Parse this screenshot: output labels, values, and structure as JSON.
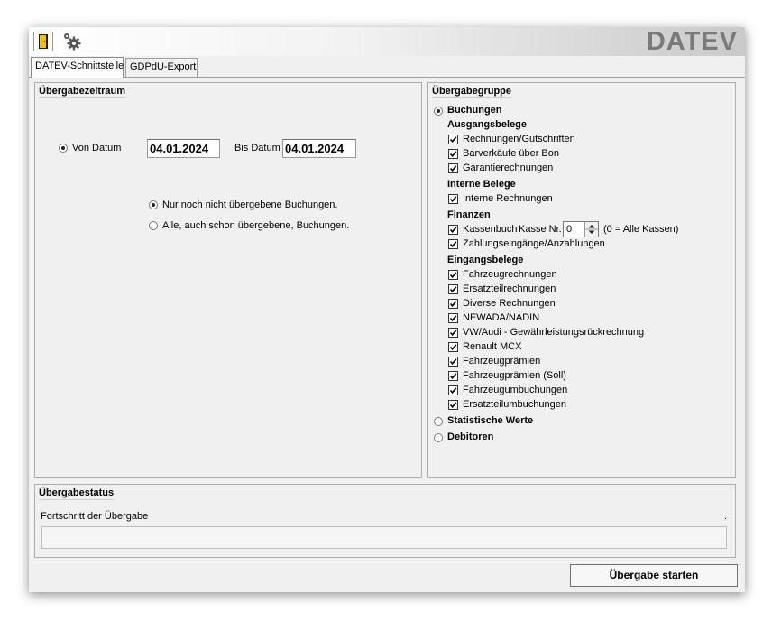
{
  "toolbar": {
    "logo": "DATEV",
    "icons": {
      "exit": "exit-door-icon",
      "settings": "gear-icon"
    },
    "colors": {
      "logo": "#7a7a7a",
      "exit_door": "#f2c200"
    }
  },
  "tabs": [
    {
      "label": "DATEV-Schnittstelle",
      "active": true
    },
    {
      "label": "GDPdU-Export",
      "active": false
    }
  ],
  "period": {
    "title": "Übergabezeitraum",
    "from_label": "Von Datum",
    "from_value": "04.01.2024",
    "to_label": "Bis Datum",
    "to_value": "04.01.2024",
    "option_new": "Nur noch nicht übergebene Buchungen.",
    "option_all": "Alle, auch schon übergebene, Buchungen."
  },
  "group": {
    "title": "Übergabegruppe",
    "bookings": "Buchungen",
    "outgoing": {
      "title": "Ausgangsbelege",
      "items": [
        "Rechnungen/Gutschriften",
        "Barverkäufe über Bon",
        "Garantierechnungen"
      ]
    },
    "internal": {
      "title": "Interne Belege",
      "items": [
        "Interne Rechnungen"
      ]
    },
    "finance": {
      "title": "Finanzen",
      "cashbook": "Kassenbuch",
      "cash_no_label": "Kasse Nr.",
      "cash_no_value": "0",
      "cash_hint": "(0 = Alle Kassen)",
      "payments": "Zahlungseingänge/Anzahlungen"
    },
    "incoming": {
      "title": "Eingangsbelege",
      "items": [
        "Fahrzeugrechnungen",
        "Ersatzteilrechnungen",
        "Diverse Rechnungen",
        "NEWADA/NADIN",
        "VW/Audi - Gewährleistungsrückrechnung",
        "Renault MCX",
        "Fahrzeugprämien",
        "Fahrzeugprämien (Soll)",
        "Fahrzeugumbuchungen",
        "Ersatzteilumbuchungen"
      ]
    },
    "stats": "Statistische Werte",
    "debtors": "Debitoren"
  },
  "status": {
    "title": "Übergabestatus",
    "progress_label": "Fortschritt der Übergabe",
    "progress_mark": ".",
    "progress": 0
  },
  "start_label": "Übergabe starten"
}
